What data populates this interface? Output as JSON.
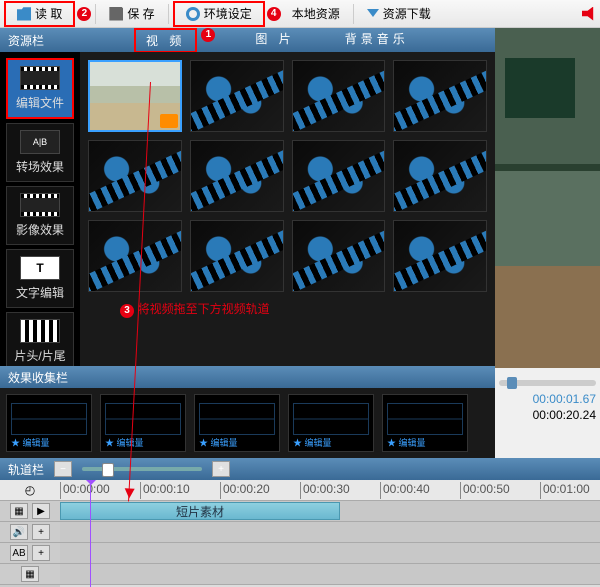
{
  "toolbar": {
    "read": "读 取",
    "save": "保 存",
    "env": "环境设定",
    "local": "本地资源",
    "download": "资源下载"
  },
  "badges": {
    "b2": "2",
    "b4": "4",
    "b1": "1",
    "b3": "3"
  },
  "resource": {
    "title": "资源栏"
  },
  "tabs": {
    "video": "视 频",
    "image": "图 片",
    "bgm": "背景音乐"
  },
  "sidebar": {
    "items": [
      {
        "label": "编辑文件"
      },
      {
        "label": "转场效果"
      },
      {
        "label": "影像效果"
      },
      {
        "label": "文字编辑"
      },
      {
        "label": "片头/片尾"
      }
    ]
  },
  "annotation": {
    "drag": "将视频拖至下方视频轨道"
  },
  "collect": {
    "title": "效果收集栏"
  },
  "preview": {
    "cur": "00:00:01.67",
    "total": "00:00:20.24"
  },
  "track": {
    "title": "轨道栏"
  },
  "ruler": [
    "00:00:00",
    "00:00:10",
    "00:00:20",
    "00:00:30",
    "00:00:40",
    "00:00:50",
    "00:01:00"
  ],
  "clip": {
    "label": "短片素材"
  }
}
